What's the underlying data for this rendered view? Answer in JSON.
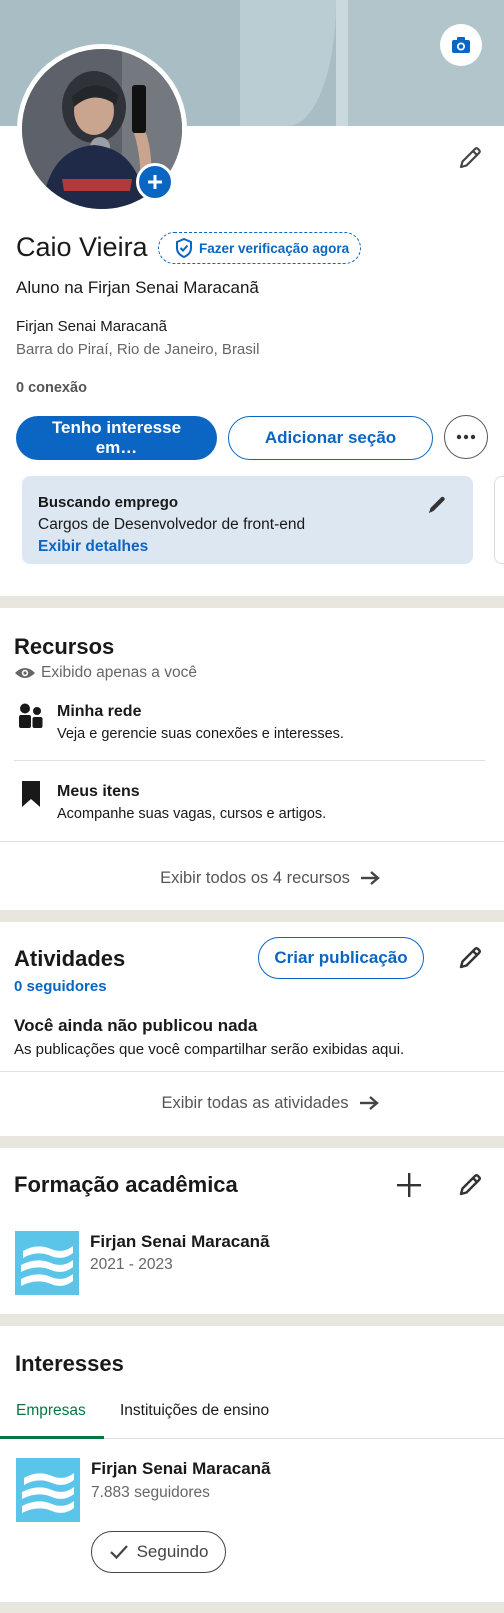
{
  "profile": {
    "name": "Caio Vieira",
    "verify_label": "Fazer verificação agora",
    "headline": "Aluno na Firjan Senai Maracanã",
    "school": "Firjan Senai Maracanã",
    "location": "Barra do Piraí, Rio de Janeiro, Brasil",
    "connections": "0 conexão",
    "interest_button": "Tenho interesse em…",
    "add_section_button": "Adicionar seção"
  },
  "job_card": {
    "title": "Buscando emprego",
    "roles": "Cargos de Desenvolvedor de front-end",
    "details_link": "Exibir detalhes"
  },
  "resources": {
    "title": "Recursos",
    "visibility": "Exibido apenas a você",
    "items": [
      {
        "title": "Minha rede",
        "subtitle": "Veja e gerencie suas conexões e interesses."
      },
      {
        "title": "Meus itens",
        "subtitle": "Acompanhe suas vagas, cursos e artigos."
      }
    ],
    "show_all": "Exibir todos os 4 recursos"
  },
  "activities": {
    "title": "Atividades",
    "followers": "0 seguidores",
    "create_post": "Criar publicação",
    "empty_title": "Você ainda não publicou nada",
    "empty_sub": "As publicações que você compartilhar serão exibidas aqui.",
    "show_all": "Exibir todas as atividades"
  },
  "education": {
    "title": "Formação acadêmica",
    "items": [
      {
        "school": "Firjan Senai Maracanã",
        "years": "2021 - 2023"
      }
    ]
  },
  "interests": {
    "title": "Interesses",
    "tabs": [
      {
        "label": "Empresas",
        "active": true
      },
      {
        "label": "Instituições de ensino",
        "active": false
      }
    ],
    "items": [
      {
        "name": "Firjan Senai Maracanã",
        "followers": "7.883 seguidores",
        "button": "Seguindo"
      }
    ]
  },
  "colors": {
    "accent": "#0a66c2",
    "tab_active": "#057642",
    "divider": "#e9e5df",
    "job_card_bg": "#dde7f1",
    "school_logo": "#5bc5e9"
  }
}
